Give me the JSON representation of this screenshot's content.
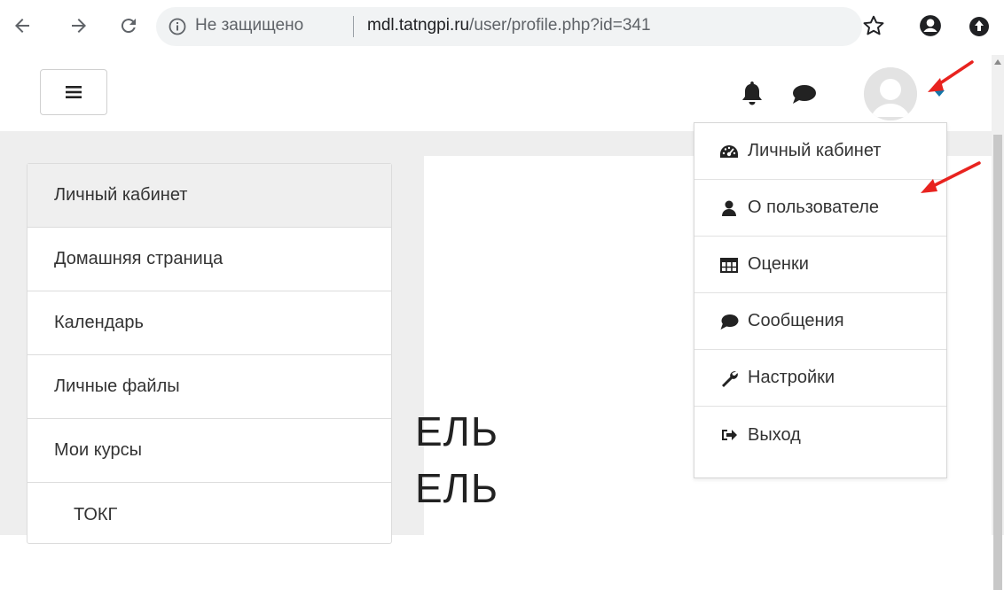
{
  "browser": {
    "back_icon": "arrow-left-icon",
    "forward_icon": "arrow-right-icon",
    "reload_icon": "reload-icon",
    "security_label": "Не защищено",
    "url_host": "mdl.tatngpi.ru",
    "url_path": "/user/profile.php?id=341"
  },
  "header": {
    "menu_icon": "hamburger-icon",
    "notifications_icon": "bell-icon",
    "messages_icon": "chat-bubble-icon",
    "avatar_icon": "user-avatar"
  },
  "sidebar": {
    "items": [
      {
        "label": "Личный кабинет"
      },
      {
        "label": "Домашняя страница"
      },
      {
        "label": "Календарь"
      },
      {
        "label": "Личные файлы"
      },
      {
        "label": "Мои курсы"
      },
      {
        "label": "ТОКГ"
      }
    ]
  },
  "main": {
    "heading_line1": "ЕЛЬ",
    "heading_line2": "ЕЛЬ"
  },
  "user_menu": {
    "items": [
      {
        "label": "Личный кабинет",
        "icon": "dashboard-icon"
      },
      {
        "label": "О пользователе",
        "icon": "user-icon"
      },
      {
        "label": "Оценки",
        "icon": "table-icon"
      },
      {
        "label": "Сообщения",
        "icon": "chat-bubble-icon"
      },
      {
        "label": "Настройки",
        "icon": "wrench-icon"
      },
      {
        "label": "Выход",
        "icon": "sign-out-icon"
      }
    ]
  },
  "colors": {
    "annotation": "#e8231f",
    "caret": "#1177aa",
    "page_bg": "#eeeeee"
  }
}
